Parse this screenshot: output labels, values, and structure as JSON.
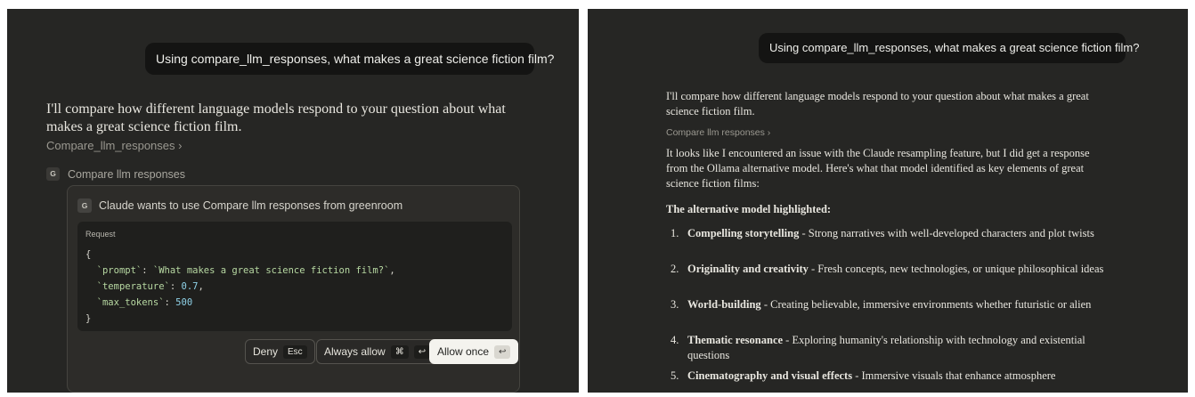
{
  "left": {
    "user_message": "Using compare_llm_responses, what makes a great science fiction film?",
    "assistant_intro": "I'll compare how different language models respond to your question about what makes a great science fiction film.",
    "compare_link": "Compare_llm_responses ›",
    "tool_badge": "G",
    "tool_label": "Compare llm responses",
    "modal": {
      "badge": "G",
      "title": "Claude wants to use Compare llm responses from greenroom",
      "request_label": "Request",
      "code": {
        "open": "{",
        "prompt_key": "`prompt`",
        "prompt_value": "`What makes a great science fiction film?`",
        "temp_key": "`temperature`",
        "temp_value": "0.7",
        "tokens_key": "`max_tokens`",
        "tokens_value": "500",
        "close": "}"
      },
      "deny_label": "Deny",
      "deny_key": "Esc",
      "always_label": "Always allow",
      "always_key1": "⌘",
      "always_key2": "↩",
      "allow_label": "Allow once",
      "allow_key": "↩"
    }
  },
  "right": {
    "user_message": "Using compare_llm_responses, what makes a great science fiction film?",
    "assistant_intro": "I'll compare how different language models respond to your question about what makes a great science fiction film.",
    "compare_link": "Compare llm responses ›",
    "issue_text": "It looks like I encountered an issue with the Claude resampling feature, but I did get a response from the Ollama alternative model. Here's what that model identified as key elements of great science fiction films:",
    "heading": "The alternative model highlighted:",
    "items": [
      {
        "num": "1.",
        "title": "Compelling storytelling",
        "desc": " - Strong narratives with well-developed characters and plot twists"
      },
      {
        "num": "2.",
        "title": "Originality and creativity",
        "desc": " - Fresh concepts, new technologies, or unique philosophical ideas"
      },
      {
        "num": "3.",
        "title": "World-building",
        "desc": " - Creating believable, immersive environments whether futuristic or alien"
      },
      {
        "num": "4.",
        "title": "Thematic resonance",
        "desc": " - Exploring humanity's relationship with technology and existential questions"
      },
      {
        "num": "5.",
        "title": "Cinematography and visual effects",
        "desc": " - Immersive visuals that enhance atmosphere"
      }
    ]
  }
}
